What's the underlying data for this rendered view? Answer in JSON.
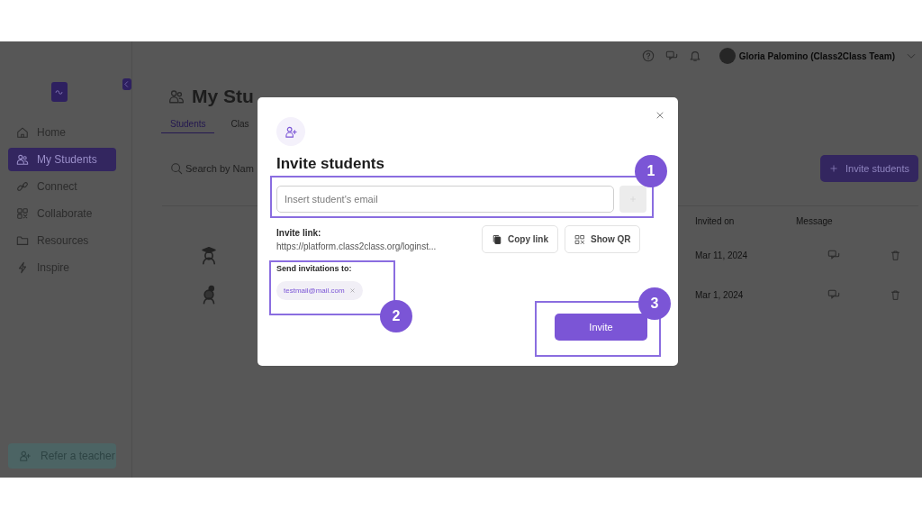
{
  "top_bar": {
    "user_name": "Gloria Palomino (Class2Class Team)"
  },
  "sidebar": {
    "items": [
      {
        "label": "Home",
        "selected": false
      },
      {
        "label": "My Students",
        "selected": true
      },
      {
        "label": "Connect",
        "selected": false
      },
      {
        "label": "Collaborate",
        "selected": false
      },
      {
        "label": "Resources",
        "selected": false
      },
      {
        "label": "Inspire",
        "selected": false
      }
    ],
    "refer_button": "Refer a teacher"
  },
  "page": {
    "title": "My Stu",
    "tabs": [
      {
        "label": "Students",
        "selected": true
      },
      {
        "label": "Clas",
        "selected": false
      }
    ],
    "search": {
      "placeholder": "Search by Nam"
    },
    "invite_button": "Invite students",
    "table": {
      "columns": [
        "Invited on",
        "Message"
      ],
      "rows": [
        {
          "invited_on": "Mar 11, 2024"
        },
        {
          "invited_on": "Mar 1, 2024"
        }
      ]
    }
  },
  "modal": {
    "title": "Invite students",
    "email_field": {
      "placeholder": "Insert student's email"
    },
    "add_button": {
      "disabled": true
    },
    "invite_link_label": "Invite link:",
    "invite_link": "https://platform.class2class.org/loginst...",
    "copy_button": "Copy link",
    "qr_button": "Show QR",
    "recipients_label": "Send invitations to:",
    "recipients": [
      {
        "email": "testmail@mail.com"
      }
    ],
    "invite_button": "Invite"
  },
  "annotations": [
    {
      "number": "1"
    },
    {
      "number": "2"
    },
    {
      "number": "3"
    }
  ]
}
